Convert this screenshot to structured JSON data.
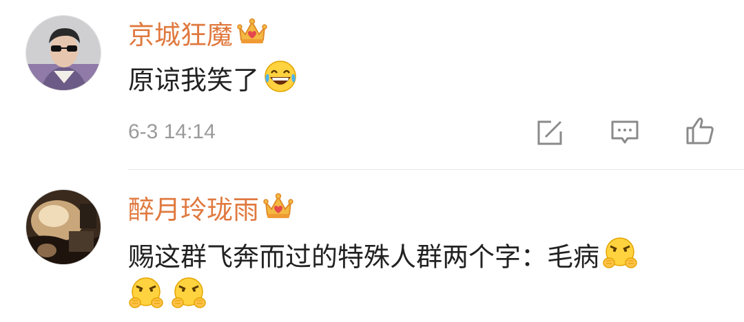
{
  "comments": [
    {
      "username": "京城狂魔",
      "text": "原谅我笑了",
      "emoji": "laugh-cry",
      "time": "6-3 14:14",
      "badge": "crown-icon"
    },
    {
      "username": "醉月玲珑雨",
      "text": "赐这群飞奔而过的特殊人群两个字：毛病",
      "emoji": "angry-fist",
      "badge": "crown-icon"
    }
  ],
  "colors": {
    "username": "#e0793f",
    "text": "#222222",
    "meta": "#9a9a9a",
    "icon": "#8a8a8a",
    "divider": "#e6e6e6"
  },
  "actions": [
    "forward-icon",
    "comment-icon",
    "like-icon"
  ]
}
